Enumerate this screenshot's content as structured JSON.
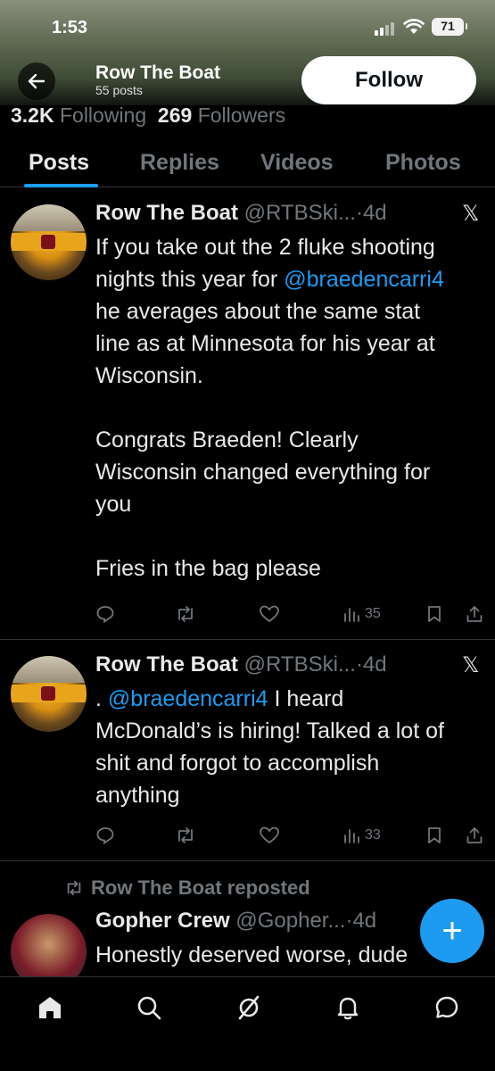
{
  "status_bar": {
    "time": "1:53",
    "battery": "71"
  },
  "header": {
    "title": "Row The Boat",
    "posts_count": "55 posts",
    "follow_label": "Follow"
  },
  "stats": {
    "following_count": "3.2K",
    "following_label": "Following",
    "followers_count": "269",
    "followers_label": "Followers"
  },
  "tabs": [
    {
      "label": "Posts",
      "active": true
    },
    {
      "label": "Replies"
    },
    {
      "label": "Videos"
    },
    {
      "label": "Photos"
    }
  ],
  "posts": [
    {
      "name": "Row The Boat",
      "handle": "@RTBSki...",
      "time": "·4d",
      "body_lines": [
        "If you take out the 2 fluke shooting",
        "nights this year for ",
        "he averages about the same stat",
        "line as at Minnesota for his year at",
        "Wisconsin.",
        "",
        "Congrats Braeden! Clearly",
        "Wisconsin changed everything for",
        "you",
        "",
        "Fries in the bag please"
      ],
      "mention": "@braedencarri4",
      "views": "35"
    },
    {
      "name": "Row The Boat",
      "handle": "@RTBSki...",
      "time": "·4d",
      "prefix": ". ",
      "mention": "@braedencarri4",
      "body_first_rest": " I heard",
      "body_lines": [
        "McDonald’s is hiring! Talked a lot of",
        "shit and forgot to accomplish",
        "anything"
      ],
      "views": "33"
    }
  ],
  "repost": {
    "label": "Row The Boat reposted",
    "name": "Gopher Crew",
    "handle": "@Gopher...",
    "time": "·4d",
    "body": "Honestly deserved worse, dude"
  },
  "fab_label": "+",
  "x_glyph": "𝕏"
}
